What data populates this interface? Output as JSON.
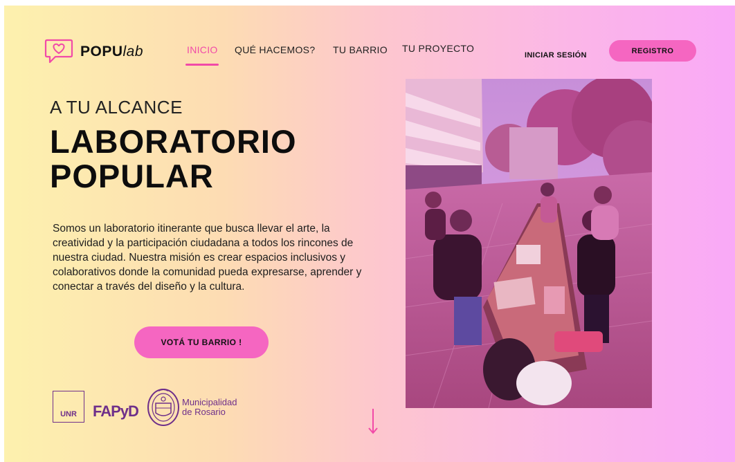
{
  "brand": {
    "name_bold": "POPU",
    "name_italic": "lab"
  },
  "nav": {
    "items": [
      {
        "label": "INICIO",
        "active": true
      },
      {
        "label": "QUÉ HACEMOS?",
        "active": false
      },
      {
        "label": "TU BARRIO",
        "active": false
      },
      {
        "label": "TU PROYECTO",
        "active": false
      }
    ],
    "login_label": "INICIAR SESIÓN",
    "register_label": "REGISTRO"
  },
  "hero": {
    "eyebrow": "A TU ALCANCE",
    "title_line1": "LABORATORIO",
    "title_line2": "POPULAR",
    "description": "Somos un laboratorio itinerante que busca llevar el arte, la creatividad y la participación ciudadana a todos los rincones de nuestra ciudad. Nuestra misión es crear espacios inclusivos y colaborativos donde la comunidad pueda expresarse, aprender y conectar a través del diseño y la cultura.",
    "cta_label": "VOTÁ TU BARRIO !"
  },
  "partners": {
    "unr": "UNR",
    "fapyd": "FAPyD",
    "municipality_line1": "Municipalidad",
    "municipality_line2": "de Rosario"
  },
  "icons": {
    "logo": "chat-heart-icon",
    "scroll": "arrow-down-icon",
    "seal": "city-seal-icon"
  },
  "colors": {
    "accent": "#f566c1",
    "active_nav": "#f14aa8",
    "partner": "#6e2f8a"
  }
}
